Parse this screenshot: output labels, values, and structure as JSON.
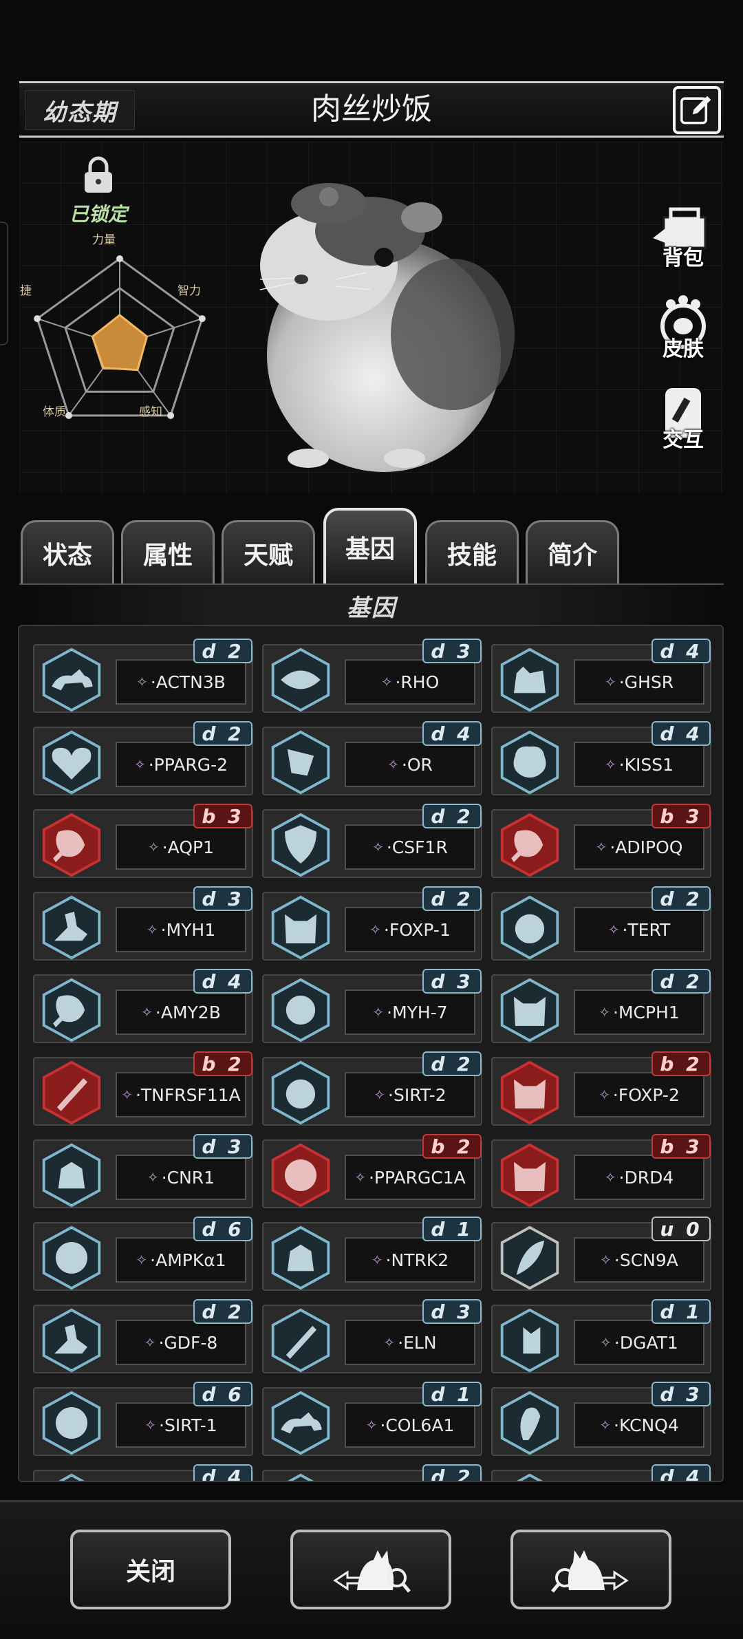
{
  "header": {
    "stage": "幼态期",
    "name": "肉丝炒饭"
  },
  "lock": {
    "label": "已锁定"
  },
  "radar": {
    "labels": [
      "力量",
      "智力",
      "感知",
      "体质",
      "敏捷"
    ],
    "values": [
      0.35,
      0.33,
      0.35,
      0.32,
      0.33
    ]
  },
  "side_buttons": [
    "背包",
    "皮肤",
    "交互"
  ],
  "tabs": [
    "状态",
    "属性",
    "天赋",
    "基因",
    "技能",
    "简介"
  ],
  "active_tab": "基因",
  "section_title": "基因",
  "genes": [
    {
      "name": "·ACTN3B",
      "badge": "d 2",
      "kind": "d",
      "icon": "cat-running-icon"
    },
    {
      "name": "·RHO",
      "badge": "d 3",
      "kind": "d",
      "icon": "eye-icon"
    },
    {
      "name": "·GHSR",
      "badge": "d 4",
      "kind": "d",
      "icon": "dog-icon"
    },
    {
      "name": "·PPARG-2",
      "badge": "d 2",
      "kind": "d",
      "icon": "heart-icon"
    },
    {
      "name": "·OR",
      "badge": "d 4",
      "kind": "d",
      "icon": "nose-icon"
    },
    {
      "name": "·KISS1",
      "badge": "d 4",
      "kind": "d",
      "icon": "brain-icon"
    },
    {
      "name": "·AQP1",
      "badge": "b 3",
      "kind": "b",
      "icon": "meat-icon"
    },
    {
      "name": "·CSF1R",
      "badge": "d 2",
      "kind": "d",
      "icon": "shield-icon"
    },
    {
      "name": "·ADIPOQ",
      "badge": "b 3",
      "kind": "b",
      "icon": "meat-icon"
    },
    {
      "name": "·MYH1",
      "badge": "d 3",
      "kind": "d",
      "icon": "arm-icon"
    },
    {
      "name": "·FOXP-1",
      "badge": "d 2",
      "kind": "d",
      "icon": "cat-head-icon"
    },
    {
      "name": "·TERT",
      "badge": "d 2",
      "kind": "d",
      "icon": "face-gauge-icon"
    },
    {
      "name": "·AMY2B",
      "badge": "d 4",
      "kind": "d",
      "icon": "meat-icon"
    },
    {
      "name": "·MYH-7",
      "badge": "d 3",
      "kind": "d",
      "icon": "cells-icon"
    },
    {
      "name": "·MCPH1",
      "badge": "d 2",
      "kind": "d",
      "icon": "cat-head-icon"
    },
    {
      "name": "·TNFRSF11A",
      "badge": "b 2",
      "kind": "b",
      "icon": "bone-icon"
    },
    {
      "name": "·SIRT-2",
      "badge": "d 2",
      "kind": "d",
      "icon": "face-gauge-icon"
    },
    {
      "name": "·FOXP-2",
      "badge": "b 2",
      "kind": "b",
      "icon": "cat-head-icon"
    },
    {
      "name": "·CNR1",
      "badge": "d 3",
      "kind": "d",
      "icon": "goat-icon"
    },
    {
      "name": "·PPARGC1A",
      "badge": "b 2",
      "kind": "b",
      "icon": "cell-ring-icon"
    },
    {
      "name": "·DRD4",
      "badge": "b 3",
      "kind": "b",
      "icon": "cat-head-icon"
    },
    {
      "name": "·AMPKα1",
      "badge": "d 6",
      "kind": "d",
      "icon": "cell-ring-icon"
    },
    {
      "name": "·NTRK2",
      "badge": "d 1",
      "kind": "d",
      "icon": "goat-icon"
    },
    {
      "name": "·SCN9A",
      "badge": "u 0",
      "kind": "u",
      "icon": "feather-icon"
    },
    {
      "name": "·GDF-8",
      "badge": "d 2",
      "kind": "d",
      "icon": "arm-icon"
    },
    {
      "name": "·ELN",
      "badge": "d 3",
      "kind": "d",
      "icon": "bone-icon"
    },
    {
      "name": "·DGAT1",
      "badge": "d 1",
      "kind": "d",
      "icon": "cat-heal-icon"
    },
    {
      "name": "·SIRT-1",
      "badge": "d 6",
      "kind": "d",
      "icon": "cell-ring-icon"
    },
    {
      "name": "·COL6A1",
      "badge": "d 1",
      "kind": "d",
      "icon": "cat-running-icon"
    },
    {
      "name": "·KCNQ4",
      "badge": "d 3",
      "kind": "d",
      "icon": "ear-icon"
    },
    {
      "name": "",
      "badge": "d 4",
      "kind": "d",
      "icon": "generic-icon"
    },
    {
      "name": "",
      "badge": "d 2",
      "kind": "d",
      "icon": "generic-icon"
    },
    {
      "name": "",
      "badge": "d 4",
      "kind": "d",
      "icon": "generic-icon"
    }
  ],
  "bottom_buttons": {
    "close": "关闭"
  },
  "colors": {
    "hex_normal": "#7fb8cc",
    "hex_bad": "#c63232",
    "hex_unknown": "#bfbfbf"
  }
}
